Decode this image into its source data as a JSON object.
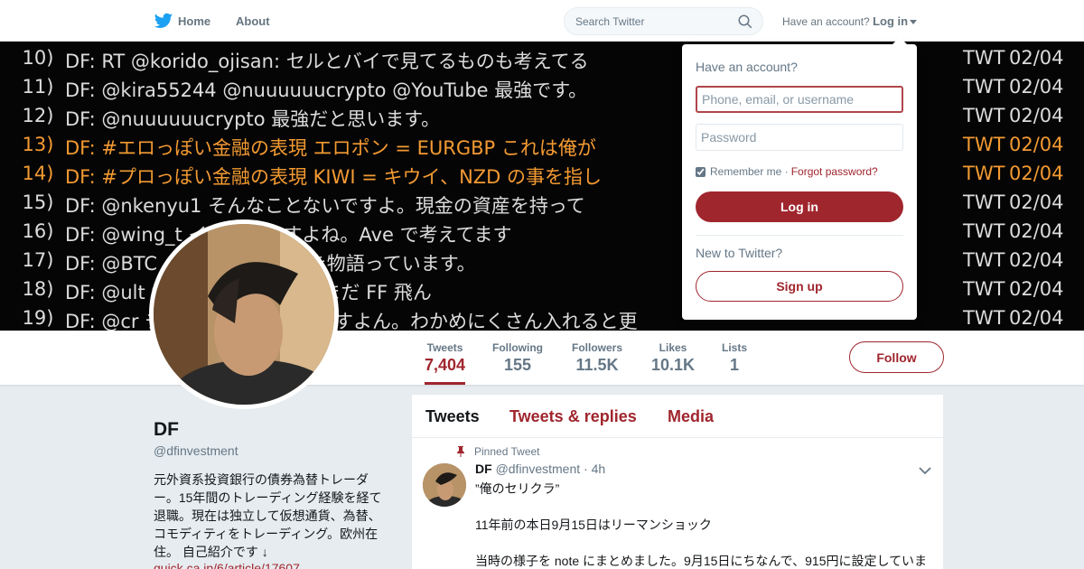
{
  "colors": {
    "accent": "#a0262e",
    "brand_bird": "#1da1f2",
    "banner_highlight": "#f39a32"
  },
  "nav": {
    "home_label": "Home",
    "about_label": "About",
    "search_placeholder": "Search Twitter",
    "have_account_text": "Have an account?",
    "login_label": "Log in"
  },
  "banner": {
    "rows": [
      {
        "num": "10)",
        "text": "DF: RT @korido_ojisan: セルとバイで見てるものも考えてる",
        "src": "TWT",
        "date": "02/04",
        "highlight": false
      },
      {
        "num": "11)",
        "text": "DF: @kira55244 @nuuuuuucrypto @YouTube 最強です。",
        "src": "TWT",
        "date": "02/04",
        "highlight": false
      },
      {
        "num": "12)",
        "text": "DF: @nuuuuuucrypto 最強だと思います。",
        "src": "TWT",
        "date": "02/04",
        "highlight": false
      },
      {
        "num": "13)",
        "text": "DF: #エロっぽい金融の表現  エロポン = EURGBP  これは俺が",
        "src": "TWT",
        "date": "02/04",
        "highlight": true
      },
      {
        "num": "14)",
        "text": "DF: #プロっぽい金融の表現  KIWI = キウイ、NZD の事を指し",
        "src": "TWT",
        "date": "02/04",
        "highlight": true
      },
      {
        "num": "15)",
        "text": "DF: @nkenyu1 そんなことないですよ。現金の資産を持って",
        "src": "TWT",
        "date": "02/04",
        "highlight": false
      },
      {
        "num": "16)",
        "text": "DF: @wing_t イミングですよね。Ave で考えてます",
        "src": "TWT",
        "date": "02/04",
        "highlight": false
      },
      {
        "num": "17)",
        "text": "DF: @BTC の U.S.A. がそれを物語っています。",
        "src": "TWT",
        "date": "02/04",
        "highlight": false
      },
      {
        "num": "18)",
        "text": "DF: @ult が多すぎる、常に。まだ FF 飛ん",
        "src": "TWT",
        "date": "02/04",
        "highlight": false
      },
      {
        "num": "19)",
        "text": "DF: @cr チャウダー的になりますよん。わかめにくさん入れると更",
        "src": "TWT",
        "date": "02/04",
        "highlight": false
      }
    ]
  },
  "stats": {
    "tweets": {
      "label": "Tweets",
      "value": "7,404"
    },
    "following": {
      "label": "Following",
      "value": "155"
    },
    "followers": {
      "label": "Followers",
      "value": "11.5K"
    },
    "likes": {
      "label": "Likes",
      "value": "10.1K"
    },
    "lists": {
      "label": "Lists",
      "value": "1"
    },
    "follow_label": "Follow"
  },
  "profile": {
    "name": "DF",
    "handle": "@dfinvestment",
    "bio": "元外資系投資銀行の債券為替トレーダー。15年間のトレーディング経験を経て退職。現在は独立して仮想通貨、為替、コモディティをトレーディング。欧州在住。 自己紹介です ↓",
    "link": "quick.ca.jp/6/article/17607"
  },
  "timeline": {
    "tabs": [
      "Tweets",
      "Tweets & replies",
      "Media"
    ],
    "pinned_label": "Pinned Tweet",
    "tweet": {
      "name": "DF",
      "handle": "@dfinvestment",
      "time": "· 4h",
      "line1": "”俺のセリクラ”",
      "line2": "11年前の本日9月15日はリーマンショック",
      "line3": "当時の様子を note にまとめました。9月15日にちなんで、915円に設定していま"
    }
  },
  "login_dropdown": {
    "title": "Have an account?",
    "username_placeholder": "Phone, email, or username",
    "password_placeholder": "Password",
    "remember_label": "Remember me ·",
    "forgot_label": "Forgot password?",
    "login_button": "Log in",
    "new_label": "New to Twitter?",
    "signup_button": "Sign up"
  }
}
